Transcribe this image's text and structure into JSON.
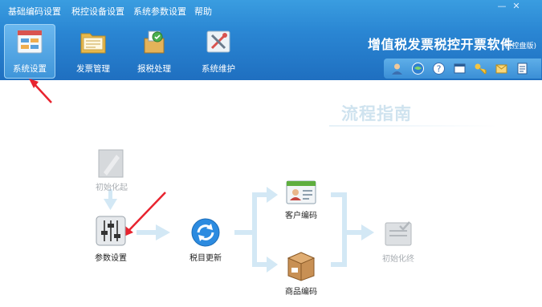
{
  "menu": {
    "items": [
      {
        "label": "基础编码设置"
      },
      {
        "label": "税控设备设置"
      },
      {
        "label": "系统参数设置"
      },
      {
        "label": "帮助"
      }
    ]
  },
  "window_controls": {
    "minimize": "—",
    "close": "✕"
  },
  "toolbar": {
    "items": [
      {
        "label": "系统设置",
        "icon": "system-settings-icon",
        "active": true
      },
      {
        "label": "发票管理",
        "icon": "invoice-folder-icon",
        "active": false
      },
      {
        "label": "报税处理",
        "icon": "tax-report-icon",
        "active": false
      },
      {
        "label": "系统维护",
        "icon": "maintenance-tools-icon",
        "active": false
      }
    ]
  },
  "app": {
    "title": "增值税发票税控开票软件",
    "subtitle": "(税控盘版)"
  },
  "quick_toolbar": {
    "icons": [
      "user-icon",
      "globe-icon",
      "help-icon",
      "window-icon",
      "key-icon",
      "mail-icon",
      "document-icon"
    ]
  },
  "flow": {
    "title": "流程指南",
    "nodes": {
      "init_start": {
        "label": "初始化起",
        "icon": "init-start-icon",
        "enabled": false
      },
      "params": {
        "label": "参数设置",
        "icon": "params-sliders-icon",
        "enabled": true
      },
      "tax_update": {
        "label": "税目更新",
        "icon": "refresh-icon",
        "enabled": true
      },
      "customer_code": {
        "label": "客户编码",
        "icon": "customer-card-icon",
        "enabled": true
      },
      "goods_code": {
        "label": "商品编码",
        "icon": "goods-box-icon",
        "enabled": true
      },
      "init_end": {
        "label": "初始化终",
        "icon": "init-end-icon",
        "enabled": false
      }
    }
  },
  "colors": {
    "header": "#2a86d3",
    "annotation_arrow": "#e8242f",
    "flow_arrow": "#c9e3f3"
  }
}
